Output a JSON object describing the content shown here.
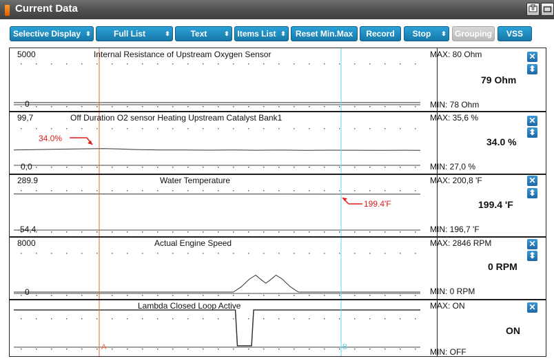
{
  "window": {
    "title": "Current Data"
  },
  "toolbar": {
    "buttons": [
      {
        "label": "Selective Display",
        "arrow": "⬍"
      },
      {
        "label": "Full List",
        "arrow": "⬍"
      },
      {
        "label": "Text",
        "arrow": "⬍"
      },
      {
        "label": "Items List",
        "arrow": "⬍"
      },
      {
        "label": "Reset Min.Max"
      },
      {
        "label": "Record"
      },
      {
        "label": "Stop",
        "arrow": "⬍"
      },
      {
        "label": "Grouping",
        "disabled": true
      },
      {
        "label": "VSS"
      }
    ]
  },
  "cursors": {
    "a": "A",
    "b": "B"
  },
  "panels": [
    {
      "title": "Internal Resistance of Upstream Oxygen Sensor",
      "max_label": "5000",
      "min_label": "0",
      "max_value": "MAX:     80 Ohm",
      "current": "79 Ohm",
      "min_value": "MIN:     78 Ohm",
      "range": [
        0,
        5000
      ],
      "series": [
        [
          0,
          79
        ],
        [
          100,
          79
        ]
      ]
    },
    {
      "title": "Off Duration O2 sensor Heating Upstream Catalyst Bank1",
      "max_label": "99,7",
      "min_label": "0,0",
      "max_value": "MAX:  35,6 %",
      "current": "34.0 %",
      "min_value": "MIN:  27,0 %",
      "annotation": "34.0%",
      "range": [
        0,
        99.7
      ],
      "series": [
        [
          0,
          31.5
        ],
        [
          6,
          32.5
        ],
        [
          12,
          33.5
        ],
        [
          18,
          34.2
        ],
        [
          22,
          34.6
        ],
        [
          26,
          33.8
        ],
        [
          30,
          32.5
        ],
        [
          36,
          31.4
        ],
        [
          42,
          31.6
        ],
        [
          48,
          31.2
        ],
        [
          54,
          31.5
        ],
        [
          60,
          31.0
        ],
        [
          66,
          31.3
        ],
        [
          72,
          30.8
        ],
        [
          78,
          31.2
        ],
        [
          84,
          31.0
        ],
        [
          90,
          30.7
        ],
        [
          96,
          31.0
        ],
        [
          100,
          30.9
        ]
      ]
    },
    {
      "title": "Water Temperature",
      "max_label": "289.9",
      "min_label": "-54,4",
      "max_value": "MAX:  200,8 'F",
      "current": "199.4 'F",
      "min_value": "MIN: 196,7 'F",
      "annotation": "199.4'F",
      "range": [
        -54.4,
        289.9
      ],
      "series": [
        [
          0,
          200.6
        ],
        [
          30,
          200.4
        ],
        [
          60,
          199.9
        ],
        [
          77,
          199.4
        ],
        [
          100,
          199.2
        ]
      ]
    },
    {
      "title": "Actual Engine Speed",
      "max_label": "8000",
      "min_label": "0",
      "max_value": "MAX:   2846 RPM",
      "current": "0 RPM",
      "min_value": "MIN:      0 RPM",
      "range": [
        0,
        8000
      ],
      "series": [
        [
          0,
          0
        ],
        [
          54,
          0
        ],
        [
          56,
          900
        ],
        [
          58,
          2200
        ],
        [
          59.5,
          2846
        ],
        [
          61,
          2000
        ],
        [
          62,
          1500
        ],
        [
          63,
          2000
        ],
        [
          64.5,
          2846
        ],
        [
          66,
          2200
        ],
        [
          68,
          900
        ],
        [
          70,
          0
        ],
        [
          100,
          0
        ]
      ]
    },
    {
      "title": "Lambda Closed Loop Active",
      "max_label": "",
      "min_label": "",
      "max_value": "MAX: ON",
      "current": "ON",
      "min_value": "MIN: OFF",
      "range": [
        0,
        1
      ],
      "series": [
        [
          0,
          1
        ],
        [
          54.5,
          1
        ],
        [
          55,
          0
        ],
        [
          58.5,
          0
        ],
        [
          59,
          1
        ],
        [
          100,
          1
        ]
      ]
    }
  ],
  "colors": {
    "cursor_a": "#e8623a",
    "cursor_b": "#5fd7ea",
    "annotation": "#e21b1b",
    "button": "#1f8cc4"
  },
  "icons": {
    "window": "capture-icon",
    "restore": "restore-icon",
    "close": "close-icon",
    "expand": "expand-icon"
  }
}
